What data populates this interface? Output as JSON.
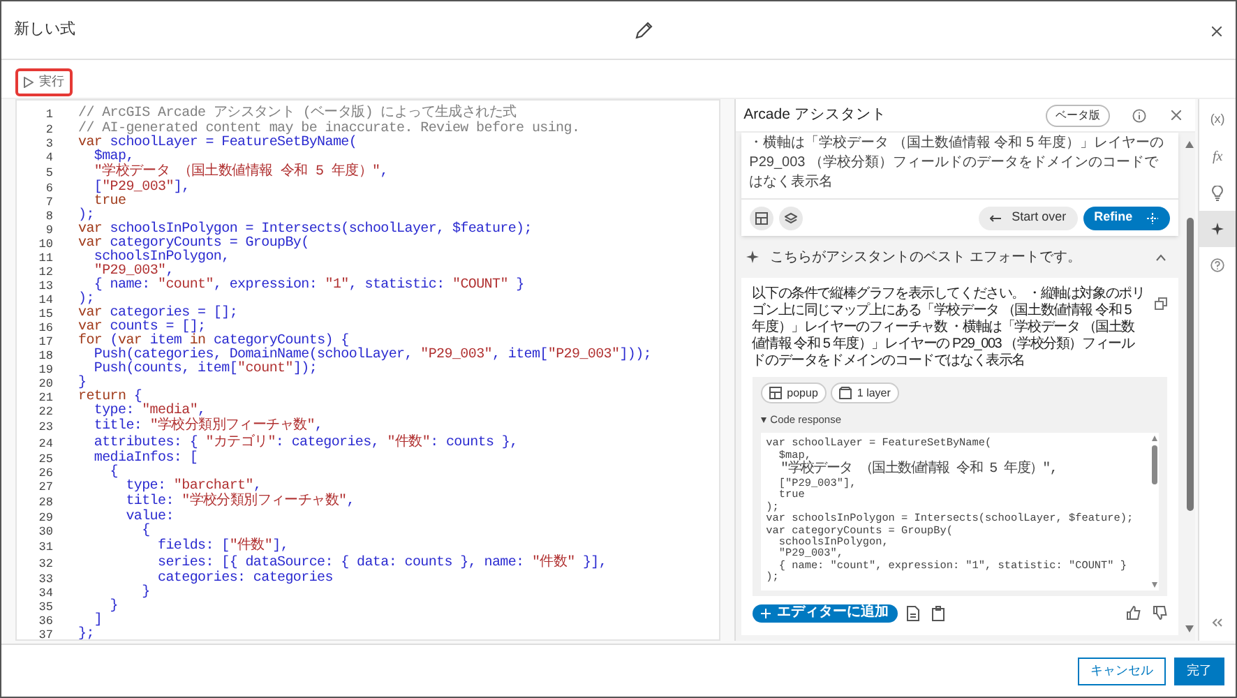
{
  "window": {
    "title": "新しい式"
  },
  "toolbar": {
    "run_label": "実行"
  },
  "editor": {
    "lines": [
      {
        "number": "1",
        "code": "// ArcGIS Arcade アシスタント (ベータ版) によって生成された式"
      },
      {
        "number": "2",
        "code": "// AI-generated content may be inaccurate. Review before using."
      },
      {
        "number": "3",
        "code": "var schoolLayer = FeatureSetByName("
      },
      {
        "number": "4",
        "code": "  $map,"
      },
      {
        "number": "5",
        "code": "  \"学校データ （国土数値情報 令和 5 年度）\","
      },
      {
        "number": "6",
        "code": "  [\"P29_003\"],"
      },
      {
        "number": "7",
        "code": "  true"
      },
      {
        "number": "8",
        "code": ");"
      },
      {
        "number": "9",
        "code": "var schoolsInPolygon = Intersects(schoolLayer, $feature);"
      },
      {
        "number": "10",
        "code": "var categoryCounts = GroupBy("
      },
      {
        "number": "11",
        "code": "  schoolsInPolygon,"
      },
      {
        "number": "12",
        "code": "  \"P29_003\","
      },
      {
        "number": "13",
        "code": "  { name: \"count\", expression: \"1\", statistic: \"COUNT\" }"
      },
      {
        "number": "14",
        "code": ");"
      },
      {
        "number": "15",
        "code": "var categories = [];"
      },
      {
        "number": "16",
        "code": "var counts = [];"
      },
      {
        "number": "17",
        "code": "for (var item in categoryCounts) {"
      },
      {
        "number": "18",
        "code": "  Push(categories, DomainName(schoolLayer, \"P29_003\", item[\"P29_003\"]));"
      },
      {
        "number": "19",
        "code": "  Push(counts, item[\"count\"]);"
      },
      {
        "number": "20",
        "code": "}"
      },
      {
        "number": "21",
        "code": "return {"
      },
      {
        "number": "22",
        "code": "  type: \"media\","
      },
      {
        "number": "23",
        "code": "  title: \"学校分類別フィーチャ数\","
      },
      {
        "number": "24",
        "code": "  attributes: { \"カテゴリ\": categories, \"件数\": counts },"
      },
      {
        "number": "25",
        "code": "  mediaInfos: ["
      },
      {
        "number": "26",
        "code": "    {"
      },
      {
        "number": "27",
        "code": "      type: \"barchart\","
      },
      {
        "number": "28",
        "code": "      title: \"学校分類別フィーチャ数\","
      },
      {
        "number": "29",
        "code": "      value:"
      },
      {
        "number": "30",
        "code": "        {"
      },
      {
        "number": "31",
        "code": "          fields: [\"件数\"],"
      },
      {
        "number": "32",
        "code": "          series: [{ dataSource: { data: counts }, name: \"件数\" }],"
      },
      {
        "number": "33",
        "code": "          categories: categories"
      },
      {
        "number": "34",
        "code": "        }"
      },
      {
        "number": "35",
        "code": "    }"
      },
      {
        "number": "36",
        "code": "  ]"
      },
      {
        "number": "37",
        "code": "};"
      }
    ]
  },
  "assistant": {
    "title": "Arcade アシスタント",
    "badge": "ベータ版",
    "prompt": {
      "value": "・横軸は「学校データ （国土数値情報 令和 5 年度）」レイヤーの P29_003 （学校分類）フィールドのデータをドメインのコードではなく表示名"
    },
    "start_over": "Start over",
    "refine": "Refine",
    "status": "こちらがアシスタントのベスト エフォートです。",
    "status_expanded": true,
    "response": {
      "text": "以下の条件で縦棒グラフを表示してください。 ・縦軸は対象のポリゴン上に同じマップ上にある「学校データ （国土数値情報 令和 5 年度）」レイヤーのフィーチャ数 ・横軸は「学校データ （国土数値情報 令和 5 年度）」レイヤーの P29_003 （学校分類）フィールドのデータをドメインのコードではなく表示名",
      "chips": [
        {
          "kind": "popup",
          "label": "popup"
        },
        {
          "kind": "layer",
          "label": "1 layer"
        }
      ],
      "code_label": "Code response",
      "code_expanded": true,
      "code_lines": [
        "var schoolLayer = FeatureSetByName(",
        "  $map,",
        "  \"学校データ （国土数値情報 令和 5 年度）\",",
        "  [\"P29_003\"],",
        "  true",
        ");",
        "var schoolsInPolygon = Intersects(schoolLayer, $feature);",
        "var categoryCounts = GroupBy(",
        "  schoolsInPolygon,",
        "  \"P29_003\",",
        "  { name: \"count\", expression: \"1\", statistic: \"COUNT\" }",
        ");"
      ],
      "add_button": "エディターに追加"
    }
  },
  "side_tools": [
    {
      "kind": "variables",
      "label": "(x)",
      "selected": false
    },
    {
      "kind": "functions",
      "label": "fx",
      "selected": false
    },
    {
      "kind": "suggestions",
      "selected": false
    },
    {
      "kind": "assistant",
      "selected": true
    },
    {
      "kind": "help",
      "selected": false
    }
  ],
  "footer": {
    "buttons": [
      {
        "kind": "secondary",
        "label": "キャンセル"
      },
      {
        "kind": "primary",
        "label": "完了"
      }
    ]
  }
}
